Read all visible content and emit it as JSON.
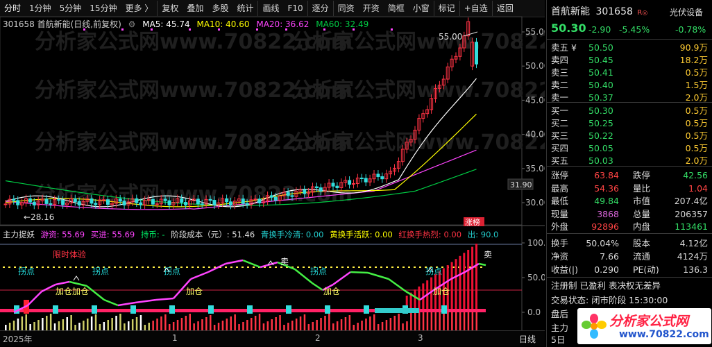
{
  "toolbar": {
    "items": [
      "分时",
      "1分钟",
      "5分钟",
      "15分钟",
      "更多 〉",
      "复权",
      "叠加",
      "多股",
      "统计",
      "画线",
      "F10",
      "逐分",
      "同资",
      "开资",
      "简框",
      "小窗",
      "标记",
      "+自选",
      "返回"
    ]
  },
  "main_legend": {
    "code_title": "301658 首航新能(日线,前复权)",
    "ma5": "MA5: 45.74",
    "ma10": "MA10: 40.60",
    "ma20": "MA20: 36.62",
    "ma60": "MA60: 32.49",
    "colors": {
      "ma5": "#ffffff",
      "ma10": "#ffff00",
      "ma20": "#ff44ff",
      "ma60": "#00cc44"
    }
  },
  "price_axis": {
    "ticks": [
      "55.00",
      "50.00",
      "45.00",
      "40.00",
      "35.00",
      "30.00"
    ],
    "current": "31.90",
    "high_label": "55.00",
    "low_label": "28.16"
  },
  "watermark": "分析家公式网www.70822.com",
  "badge": "涨榜",
  "indicator_legend": {
    "name": "主力捉妖",
    "youzi": "游资: 55.69",
    "maijin": "买进: 55.69",
    "chibi": "持币: -",
    "cost": "阶段成本（元）: 51.46",
    "qing": "青换手冷清: 0.00",
    "huang": "黄换手活跃: 0.00",
    "hong": "红换手热烈: 0.00",
    "chu": "出: 90.0"
  },
  "indicator_axis": {
    "ticks": [
      "100.0",
      "50.0",
      "0.0"
    ]
  },
  "indicator_labels": {
    "trial": "限时体验",
    "guaidian": "拐点",
    "jiacang": "加仓",
    "jiacang2": "加仓加仓",
    "mai": "卖"
  },
  "x_axis": {
    "labels": [
      "2025年",
      "1",
      "2",
      "3"
    ],
    "period": "日线"
  },
  "stock": {
    "name": "首航新能",
    "code": "301658",
    "tag": "R",
    "sector": "光伏设备",
    "sector_change": "-0.78%",
    "price": "50.30",
    "change": "-2.90",
    "change_pct": "-5.45%"
  },
  "order_book": {
    "asks": [
      {
        "label": "卖五 ¥",
        "price": "50.50",
        "vol": "90.9万"
      },
      {
        "label": "卖四",
        "price": "50.45",
        "vol": "18.2万"
      },
      {
        "label": "卖三",
        "price": "50.41",
        "vol": "0.5万"
      },
      {
        "label": "卖二",
        "price": "50.40",
        "vol": "1.5万"
      },
      {
        "label": "卖一",
        "price": "50.37",
        "vol": "2.0万"
      }
    ],
    "bids": [
      {
        "label": "买一",
        "price": "50.30",
        "vol": "0.5万"
      },
      {
        "label": "买二",
        "price": "50.25",
        "vol": "0.5万"
      },
      {
        "label": "买三",
        "price": "50.22",
        "vol": "0.5万"
      },
      {
        "label": "买四",
        "price": "50.05",
        "vol": "0.5万"
      },
      {
        "label": "买五",
        "price": "50.03",
        "vol": "2.0万"
      }
    ]
  },
  "stats": [
    {
      "l1": "涨停",
      "v1": "63.84",
      "c1": "#ff4444",
      "l2": "跌停",
      "v2": "42.56",
      "c2": "#33dd66"
    },
    {
      "l1": "最高",
      "v1": "54.36",
      "c1": "#ff4444",
      "l2": "量比",
      "v2": "1.04",
      "c2": "#ff4444"
    },
    {
      "l1": "最低",
      "v1": "49.84",
      "c1": "#33dd66",
      "l2": "市值",
      "v2": "207.4亿",
      "c2": "#d8d8d8"
    },
    {
      "l1": "现量",
      "v1": "3868",
      "c1": "#dd66dd",
      "l2": "总量",
      "v2": "206357",
      "c2": "#d8d8d8"
    },
    {
      "l1": "外盘",
      "v1": "92896",
      "c1": "#ff4444",
      "l2": "内盘",
      "v2": "113461",
      "c2": "#33dd66"
    }
  ],
  "stats2": [
    {
      "l1": "换手",
      "v1": "50.04%",
      "l2": "股本",
      "v2": "4.12亿"
    },
    {
      "l1": "净资",
      "v1": "7.66",
      "l2": "流通",
      "v2": "4124万"
    },
    {
      "l1": "收益(|)",
      "v1": "0.290",
      "l2": "PE(动)",
      "v2": "136.3"
    }
  ],
  "notes": {
    "line1": "注册制 已盈利 表决权无差异",
    "line2": "交易状态: 闭市阶段 15:30:00",
    "line3": "盘后",
    "line4": "主力",
    "line5": "5日"
  },
  "logo": {
    "text": "分析家公式网",
    "url": "www.70822.com"
  }
}
